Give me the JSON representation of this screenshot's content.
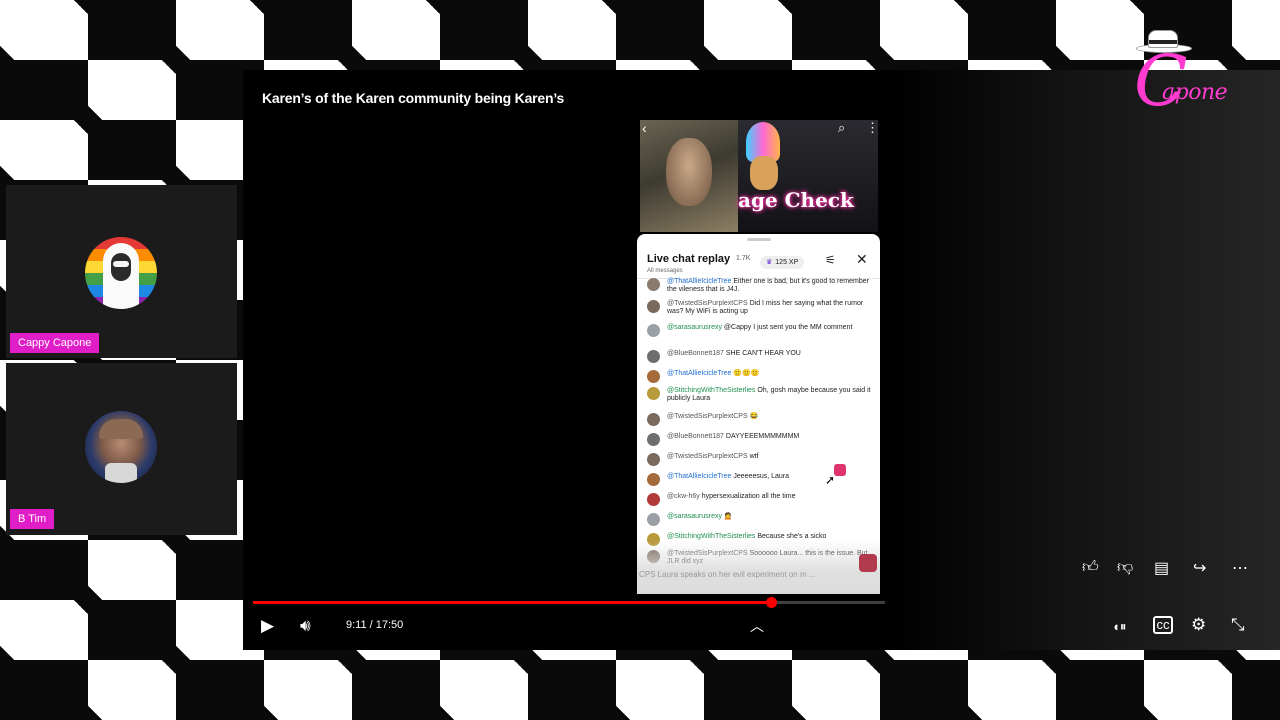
{
  "player": {
    "title": "Karen’s of the Karen community being Karen’s",
    "time": "9:11 / 17:50",
    "progress_fraction": 0.82,
    "controls": {
      "play_icon": "play-icon",
      "volume_icon": "volume-icon",
      "chevron_icon": "chevron-up-icon",
      "autoplay_icon": "autoplay-toggle-icon",
      "captions_icon": "captions-icon",
      "settings_icon": "settings-icon",
      "fullscreen_exit_icon": "fullscreen-exit-icon"
    },
    "actions": [
      "like-icon",
      "dislike-icon",
      "comments-icon",
      "share-icon",
      "more-icon"
    ]
  },
  "embedded": {
    "overlay_text": "age Check",
    "chat": {
      "title": "Live chat replay",
      "count": "1.7K",
      "subtitle": "All messages",
      "xp": "125 XP",
      "messages": [
        {
          "user": "@ThatAllieIcicleTree",
          "style": "blue",
          "text": "Either one is bad, but it's good to remember the vileness that is J4J."
        },
        {
          "user": "@TwistedSisPurplextCPS",
          "style": "plain",
          "text": "Did I miss her saying what the rumor was? My WiFi is acting up"
        },
        {
          "user": "@sarasaurusrexy",
          "style": "green",
          "text": "@Cappy I just sent you the MM comment"
        },
        {
          "user": "@BlueBonnett187",
          "style": "plain",
          "text": "SHE CAN'T HEAR YOU"
        },
        {
          "user": "@ThatAllieIcicleTree",
          "style": "blue",
          "text": "🙂🙂🙂"
        },
        {
          "user": "@StitchingWithTheSisterlies",
          "style": "green",
          "text": "Oh, gosh maybe because you said it publicly Laura"
        },
        {
          "user": "@TwistedSisPurplextCPS",
          "style": "plain",
          "text": "😂"
        },
        {
          "user": "@BlueBonnett187",
          "style": "plain",
          "text": "DAYYEEEMMMMMMM"
        },
        {
          "user": "@TwistedSisPurplextCPS",
          "style": "plain",
          "text": "wtf"
        },
        {
          "user": "@ThatAllieIcicleTree",
          "style": "blue",
          "text": "Jeeeeesus, Laura"
        },
        {
          "user": "@ckw-h6y",
          "style": "plain",
          "text": "hypersexualization all the time"
        },
        {
          "user": "@sarasaurusrexy",
          "style": "green",
          "text": "🙍"
        },
        {
          "user": "@StitchingWithTheSisterlies",
          "style": "green",
          "text": "Because she's a sicko"
        },
        {
          "user": "@TwistedSisPurplextCPS",
          "style": "plain",
          "text": "Soooooo Laura... this is the issue. But JLR did xyz"
        }
      ],
      "caption": "CPS Laura speaks on her evil experiment on m ..."
    }
  },
  "participants": [
    {
      "name": "Cappy Capone"
    },
    {
      "name": "B Tim"
    }
  ],
  "logo": {
    "letter": "C",
    "text": "apone"
  },
  "colors": {
    "progress": "#ff0000",
    "name_tag": "#e01ec8",
    "logo": "#ff3bd0"
  }
}
